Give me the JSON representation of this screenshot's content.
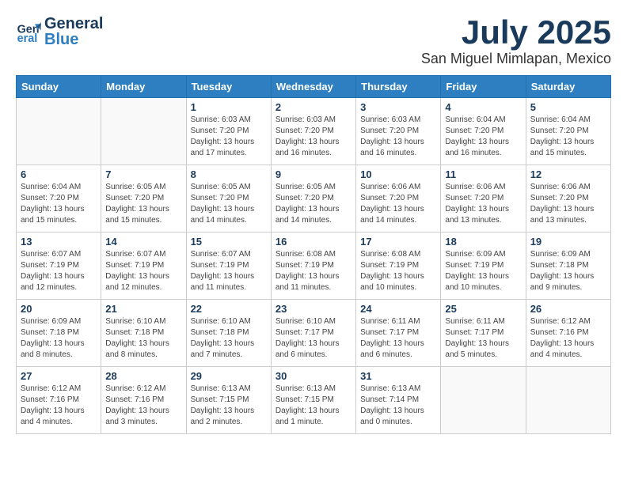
{
  "header": {
    "logo_general": "General",
    "logo_blue": "Blue",
    "month": "July 2025",
    "location": "San Miguel Mimlapan, Mexico"
  },
  "weekdays": [
    "Sunday",
    "Monday",
    "Tuesday",
    "Wednesday",
    "Thursday",
    "Friday",
    "Saturday"
  ],
  "weeks": [
    [
      {
        "day": "",
        "detail": ""
      },
      {
        "day": "",
        "detail": ""
      },
      {
        "day": "1",
        "detail": "Sunrise: 6:03 AM\nSunset: 7:20 PM\nDaylight: 13 hours\nand 17 minutes."
      },
      {
        "day": "2",
        "detail": "Sunrise: 6:03 AM\nSunset: 7:20 PM\nDaylight: 13 hours\nand 16 minutes."
      },
      {
        "day": "3",
        "detail": "Sunrise: 6:03 AM\nSunset: 7:20 PM\nDaylight: 13 hours\nand 16 minutes."
      },
      {
        "day": "4",
        "detail": "Sunrise: 6:04 AM\nSunset: 7:20 PM\nDaylight: 13 hours\nand 16 minutes."
      },
      {
        "day": "5",
        "detail": "Sunrise: 6:04 AM\nSunset: 7:20 PM\nDaylight: 13 hours\nand 15 minutes."
      }
    ],
    [
      {
        "day": "6",
        "detail": "Sunrise: 6:04 AM\nSunset: 7:20 PM\nDaylight: 13 hours\nand 15 minutes."
      },
      {
        "day": "7",
        "detail": "Sunrise: 6:05 AM\nSunset: 7:20 PM\nDaylight: 13 hours\nand 15 minutes."
      },
      {
        "day": "8",
        "detail": "Sunrise: 6:05 AM\nSunset: 7:20 PM\nDaylight: 13 hours\nand 14 minutes."
      },
      {
        "day": "9",
        "detail": "Sunrise: 6:05 AM\nSunset: 7:20 PM\nDaylight: 13 hours\nand 14 minutes."
      },
      {
        "day": "10",
        "detail": "Sunrise: 6:06 AM\nSunset: 7:20 PM\nDaylight: 13 hours\nand 14 minutes."
      },
      {
        "day": "11",
        "detail": "Sunrise: 6:06 AM\nSunset: 7:20 PM\nDaylight: 13 hours\nand 13 minutes."
      },
      {
        "day": "12",
        "detail": "Sunrise: 6:06 AM\nSunset: 7:20 PM\nDaylight: 13 hours\nand 13 minutes."
      }
    ],
    [
      {
        "day": "13",
        "detail": "Sunrise: 6:07 AM\nSunset: 7:19 PM\nDaylight: 13 hours\nand 12 minutes."
      },
      {
        "day": "14",
        "detail": "Sunrise: 6:07 AM\nSunset: 7:19 PM\nDaylight: 13 hours\nand 12 minutes."
      },
      {
        "day": "15",
        "detail": "Sunrise: 6:07 AM\nSunset: 7:19 PM\nDaylight: 13 hours\nand 11 minutes."
      },
      {
        "day": "16",
        "detail": "Sunrise: 6:08 AM\nSunset: 7:19 PM\nDaylight: 13 hours\nand 11 minutes."
      },
      {
        "day": "17",
        "detail": "Sunrise: 6:08 AM\nSunset: 7:19 PM\nDaylight: 13 hours\nand 10 minutes."
      },
      {
        "day": "18",
        "detail": "Sunrise: 6:09 AM\nSunset: 7:19 PM\nDaylight: 13 hours\nand 10 minutes."
      },
      {
        "day": "19",
        "detail": "Sunrise: 6:09 AM\nSunset: 7:18 PM\nDaylight: 13 hours\nand 9 minutes."
      }
    ],
    [
      {
        "day": "20",
        "detail": "Sunrise: 6:09 AM\nSunset: 7:18 PM\nDaylight: 13 hours\nand 8 minutes."
      },
      {
        "day": "21",
        "detail": "Sunrise: 6:10 AM\nSunset: 7:18 PM\nDaylight: 13 hours\nand 8 minutes."
      },
      {
        "day": "22",
        "detail": "Sunrise: 6:10 AM\nSunset: 7:18 PM\nDaylight: 13 hours\nand 7 minutes."
      },
      {
        "day": "23",
        "detail": "Sunrise: 6:10 AM\nSunset: 7:17 PM\nDaylight: 13 hours\nand 6 minutes."
      },
      {
        "day": "24",
        "detail": "Sunrise: 6:11 AM\nSunset: 7:17 PM\nDaylight: 13 hours\nand 6 minutes."
      },
      {
        "day": "25",
        "detail": "Sunrise: 6:11 AM\nSunset: 7:17 PM\nDaylight: 13 hours\nand 5 minutes."
      },
      {
        "day": "26",
        "detail": "Sunrise: 6:12 AM\nSunset: 7:16 PM\nDaylight: 13 hours\nand 4 minutes."
      }
    ],
    [
      {
        "day": "27",
        "detail": "Sunrise: 6:12 AM\nSunset: 7:16 PM\nDaylight: 13 hours\nand 4 minutes."
      },
      {
        "day": "28",
        "detail": "Sunrise: 6:12 AM\nSunset: 7:16 PM\nDaylight: 13 hours\nand 3 minutes."
      },
      {
        "day": "29",
        "detail": "Sunrise: 6:13 AM\nSunset: 7:15 PM\nDaylight: 13 hours\nand 2 minutes."
      },
      {
        "day": "30",
        "detail": "Sunrise: 6:13 AM\nSunset: 7:15 PM\nDaylight: 13 hours\nand 1 minute."
      },
      {
        "day": "31",
        "detail": "Sunrise: 6:13 AM\nSunset: 7:14 PM\nDaylight: 13 hours\nand 0 minutes."
      },
      {
        "day": "",
        "detail": ""
      },
      {
        "day": "",
        "detail": ""
      }
    ]
  ]
}
